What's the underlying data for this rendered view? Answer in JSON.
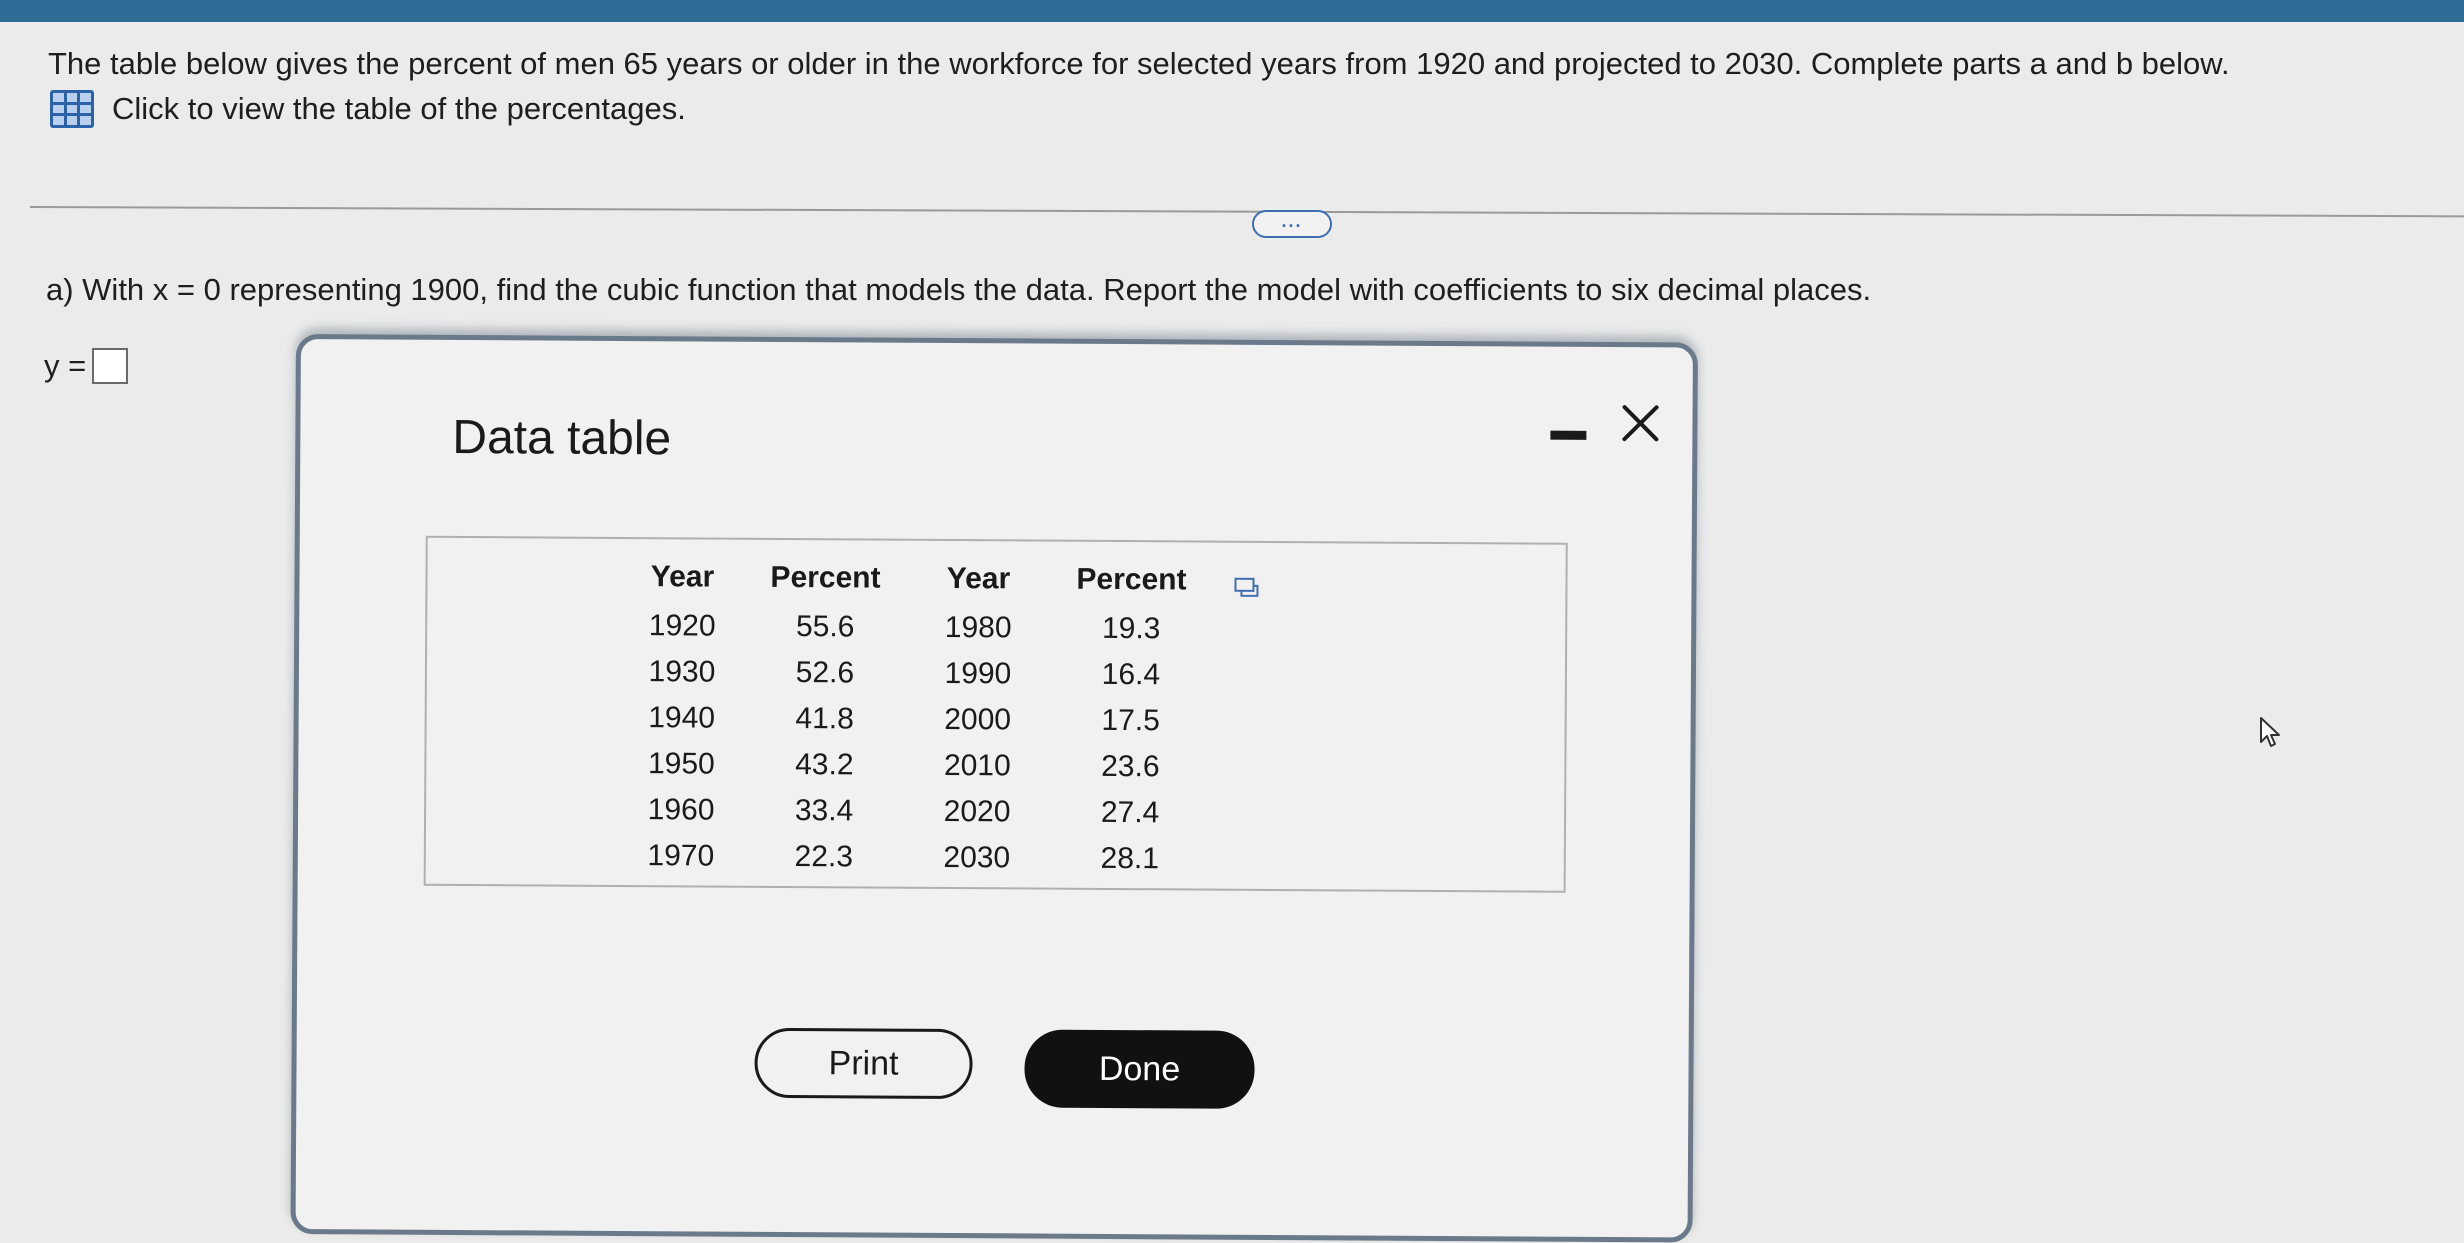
{
  "problem": {
    "intro": "The table below gives the percent of men 65 years or older in the workforce for selected years from 1920 and projected to 2030. Complete parts a and b below.",
    "table_link_label": "Click to view the table of the percentages.",
    "more_label": "...",
    "part_a": "a) With x = 0 representing 1900, find the cubic function that models the data. Report the model with coefficients to six decimal places.",
    "answer_prefix": "y ="
  },
  "modal": {
    "title": "Data table",
    "headers": [
      "Year",
      "Percent",
      "Year",
      "Percent"
    ],
    "rows": [
      [
        "1920",
        "55.6",
        "1980",
        "19.3"
      ],
      [
        "1930",
        "52.6",
        "1990",
        "16.4"
      ],
      [
        "1940",
        "41.8",
        "2000",
        "17.5"
      ],
      [
        "1950",
        "43.2",
        "2010",
        "23.6"
      ],
      [
        "1960",
        "33.4",
        "2020",
        "27.4"
      ],
      [
        "1970",
        "22.3",
        "2030",
        "28.1"
      ]
    ],
    "print_label": "Print",
    "done_label": "Done"
  },
  "icons": {
    "table": "grid-table-icon",
    "minimize": "minimize-icon",
    "close": "close-icon",
    "copy": "copy-icon",
    "cursor": "mouse-pointer-icon"
  },
  "colors": {
    "top_bar": "#2f6d96",
    "link_icon": "#2b62a8",
    "done_button": "#111111"
  }
}
